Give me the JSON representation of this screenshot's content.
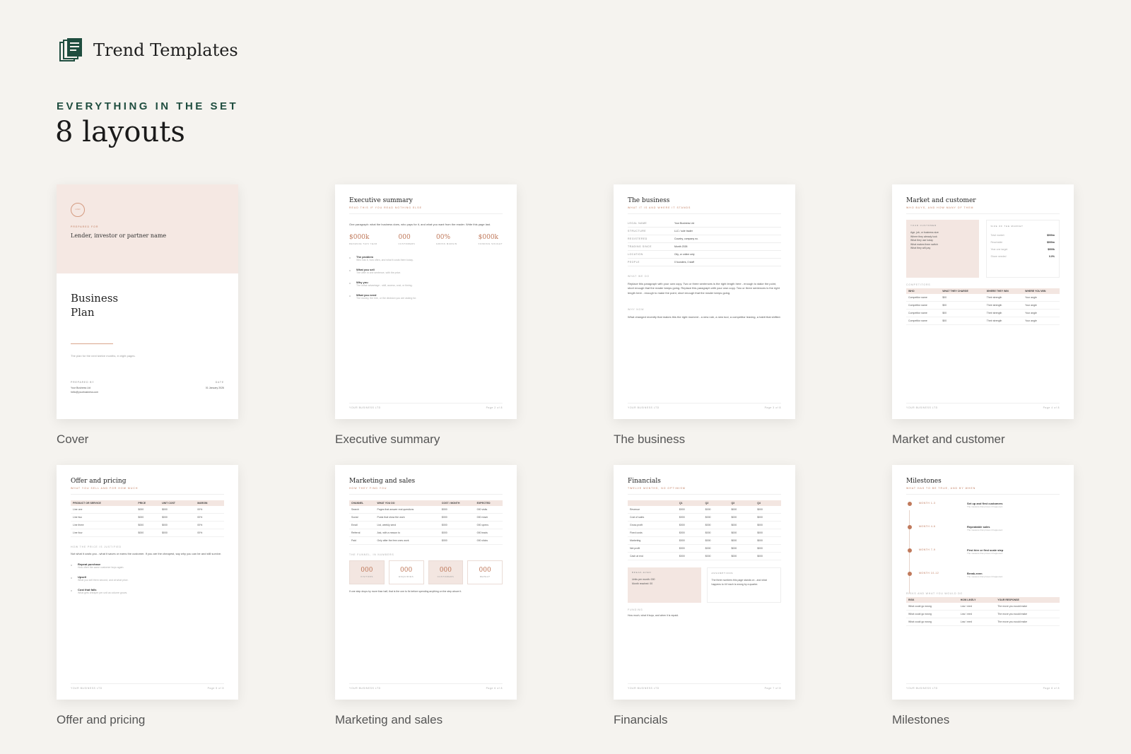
{
  "brand": {
    "name": "Trend Templates"
  },
  "section": {
    "eyebrow": "EVERYTHING IN THE SET",
    "title": "8 layouts"
  },
  "cards": {
    "cover": {
      "caption": "Cover",
      "seal": "LOGO",
      "prepared_for_label": "PREPARED FOR",
      "recipient": "Lender, investor or partner name",
      "title_line1": "Business",
      "title_line2": "Plan",
      "tagline": "The plan for the next twelve months, in eight pages.",
      "prepared_by_label": "PREPARED BY",
      "prepared_by_name": "Your Business Ltd",
      "prepared_by_email": "hello@yourbusiness.com",
      "date_label": "DATE",
      "date_value": "01 January 2026"
    },
    "exec": {
      "caption": "Executive summary",
      "title": "Executive summary",
      "sub": "READ THIS IF YOU READ NOTHING ELSE",
      "intro": "One paragraph: what the business does, who pays for it, and what you want from the reader. Write this page last.",
      "stats": [
        {
          "value": "$000k",
          "label": "REVENUE THIS YEAR"
        },
        {
          "value": "000",
          "label": "CUSTOMERS"
        },
        {
          "value": "00%",
          "label": "GROSS MARGIN"
        },
        {
          "value": "$000k",
          "label": "FUNDING SOUGHT"
        }
      ],
      "items": [
        {
          "title": "The problem",
          "text": "Who has it, how often, and what it costs them today."
        },
        {
          "title": "What you sell",
          "text": "The offer in one sentence, with the price."
        },
        {
          "title": "Why you",
          "text": "The unfair advantage - skill, access, cost, or timing."
        },
        {
          "title": "What you need",
          "text": "The money, the hire, or the decision you are asking for."
        }
      ],
      "footer_left": "YOUR BUSINESS LTD",
      "footer_right": "Page 2 of 8"
    },
    "business": {
      "caption": "The business",
      "title": "The business",
      "sub": "WHAT IT IS AND WHERE IT STANDS",
      "rows": [
        {
          "k": "LEGAL NAME",
          "v": "Your Business Ltd"
        },
        {
          "k": "STRUCTURE",
          "v": "LLC / sole trader"
        },
        {
          "k": "REGISTERED",
          "v": "Country, company no."
        },
        {
          "k": "TRADING SINCE",
          "v": "Month 2026"
        },
        {
          "k": "LOCATION",
          "v": "City, or online only"
        },
        {
          "k": "PEOPLE",
          "v": "0 founders, 0 staff"
        }
      ],
      "what_label": "WHAT WE DO",
      "what_text": "Replace this paragraph with your own copy. Two or three sentences is the right length here - enough to stake the point, short enough that the reader keeps going. Replace this paragraph with your own copy. Two or three sentences is the right length here - enough to make the point, short enough that the reader keeps going.",
      "why_label": "WHY NOW",
      "why_text": "What changed recently that makes this the right moment - a new rule, a new tool, a competitor leaving, a habit that shifted.",
      "footer_left": "YOUR BUSINESS LTD",
      "footer_right": "Page 3 of 8"
    },
    "market": {
      "caption": "Market and customer",
      "title": "Market and customer",
      "sub": "WHO BUYS, AND HOW MANY OF THEM",
      "customer_label": "YOUR CUSTOMER",
      "customer_items": [
        "Age, job, or business size",
        "Where they already look",
        "What they use today",
        "What makes them switch",
        "What they will pay"
      ],
      "size_label": "SIZE OF THE MARKET",
      "sizes": [
        {
          "k": "Total market",
          "v": "$000m"
        },
        {
          "k": "Reachable",
          "v": "$000m"
        },
        {
          "k": "Year one target",
          "v": "$000k"
        },
        {
          "k": "Share needed",
          "v": "0.0%"
        }
      ],
      "comp_label": "COMPETITORS",
      "comp_headers": [
        "WHO",
        "WHAT THEY CHARGE",
        "WHERE THEY WIN",
        "WHERE YOU WIN"
      ],
      "comp_rows": [
        [
          "Competitor name",
          "$00",
          "Their strength",
          "Your angle"
        ],
        [
          "Competitor name",
          "$00",
          "Their strength",
          "Your angle"
        ],
        [
          "Competitor name",
          "$00",
          "Their strength",
          "Your angle"
        ],
        [
          "Competitor name",
          "$00",
          "Their strength",
          "Your angle"
        ]
      ],
      "footer_left": "YOUR BUSINESS LTD",
      "footer_right": "Page 4 of 8"
    },
    "offer": {
      "caption": "Offer and pricing",
      "title": "Offer and pricing",
      "sub": "WHAT YOU SELL AND FOR HOW MUCH",
      "headers": [
        "PRODUCT OR SERVICE",
        "PRICE",
        "UNIT COST",
        "MARGIN"
      ],
      "rows": [
        [
          "Line one",
          "$000",
          "$000",
          "00%"
        ],
        [
          "Line two",
          "$000",
          "$000",
          "00%"
        ],
        [
          "Line three",
          "$000",
          "$000",
          "00%"
        ],
        [
          "Line four",
          "$000",
          "$000",
          "00%"
        ]
      ],
      "justify_label": "HOW THE PRICE IS JUSTIFIED",
      "justify_text": "Not what it costs you - what it saves or earns the customer. If you are the cheapest, say why you can be and still survive.",
      "items": [
        {
          "title": "Repeat purchase",
          "text": "How often the same customer buys again."
        },
        {
          "title": "Upsell",
          "text": "What you sell them second, and at what price."
        },
        {
          "title": "Cost that falls",
          "text": "What gets cheaper per unit as volume grows."
        }
      ],
      "footer_left": "YOUR BUSINESS LTD",
      "footer_right": "Page 5 of 8"
    },
    "marketing": {
      "caption": "Marketing and sales",
      "title": "Marketing and sales",
      "sub": "HOW THEY FIND YOU",
      "headers": [
        "CHANNEL",
        "WHAT YOU DO",
        "COST / MONTH",
        "EXPECTED"
      ],
      "rows": [
        [
          "Search",
          "Pages that answer real questions",
          "$000",
          "000 visits"
        ],
        [
          "Social",
          "Posts that show the work",
          "$000",
          "000 reach"
        ],
        [
          "Email",
          "List, weekly send",
          "$000",
          "000 opens"
        ],
        [
          "Referral",
          "Ask, with a reason to",
          "$000",
          "000 leads"
        ],
        [
          "Paid",
          "Only after the free ones work",
          "$000",
          "000 clicks"
        ]
      ],
      "funnel_label": "THE FUNNEL, IN NUMBERS",
      "funnel": [
        {
          "value": "000",
          "label": "VISITORS"
        },
        {
          "value": "000",
          "label": "ENQUIRIES"
        },
        {
          "value": "000",
          "label": "CUSTOMERS"
        },
        {
          "value": "000",
          "label": "REPEAT"
        }
      ],
      "note": "If one step drops by more than half, that is the one to fix before spending anything on the step above it.",
      "footer_left": "YOUR BUSINESS LTD",
      "footer_right": "Page 6 of 8"
    },
    "financials": {
      "caption": "Financials",
      "title": "Financials",
      "sub": "TWELVE MONTHS, NO OPTIMISM",
      "headers": [
        "",
        "Q1",
        "Q2",
        "Q3",
        "Q4"
      ],
      "rows": [
        [
          "Revenue",
          "$000",
          "$000",
          "$000",
          "$000"
        ],
        [
          "Cost of sales",
          "$000",
          "$000",
          "$000",
          "$000"
        ],
        [
          "Gross profit",
          "$000",
          "$000",
          "$000",
          "$000"
        ],
        [
          "Fixed costs",
          "$000",
          "$000",
          "$000",
          "$000"
        ],
        [
          "Marketing",
          "$000",
          "$000",
          "$000",
          "$000"
        ],
        [
          "Net profit",
          "$000",
          "$000",
          "$000",
          "$000"
        ],
        [
          "Cash at end",
          "$000",
          "$000",
          "$000",
          "$000"
        ]
      ],
      "breakeven_label": "BREAK-EVEN",
      "breakeven_1": "Units per month: 000",
      "breakeven_2": "Month reached: 00",
      "assumptions_label": "ASSUMPTIONS",
      "assumptions_text": "The three numbers this page stands on - and what happens to it if each is wrong by a quarter.",
      "funding_label": "FUNDING",
      "funding_text": "How much, what it buys, and when it is repaid.",
      "footer_left": "YOUR BUSINESS LTD",
      "footer_right": "Page 7 of 8"
    },
    "milestones": {
      "caption": "Milestones",
      "title": "Milestones",
      "sub": "WHAT HAS TO BE TRUE, AND BY WHEN",
      "steps": [
        {
          "when": "MONTH 1-3",
          "title": "Set up and first customers",
          "text": "The measure that proves it happened."
        },
        {
          "when": "MONTH 4-6",
          "title": "Repeatable sales",
          "text": "The measure that proves it happened."
        },
        {
          "when": "MONTH 7-9",
          "title": "First hire or first scale step",
          "text": "The measure that proves it happened."
        },
        {
          "when": "MONTH 10-12",
          "title": "Break-even",
          "text": "The measure that proves it happened."
        }
      ],
      "risk_label": "RISKS AND WHAT YOU WOULD DO",
      "risk_headers": [
        "RISK",
        "HOW LIKELY",
        "YOUR RESPONSE"
      ],
      "risk_rows": [
        [
          "What could go wrong",
          "Low / med",
          "The move you would make"
        ],
        [
          "What could go wrong",
          "Low / med",
          "The move you would make"
        ],
        [
          "What could go wrong",
          "Low / med",
          "The move you would make"
        ]
      ],
      "footer_left": "YOUR BUSINESS LTD",
      "footer_right": "Page 8 of 8"
    }
  },
  "colors": {
    "accent_green": "#1f4d3f",
    "accent_terracotta": "#c07a5c",
    "blush": "#f5e8e3",
    "background": "#f5f3ef"
  },
  "icons": {
    "brand": "stacked-documents-icon"
  }
}
